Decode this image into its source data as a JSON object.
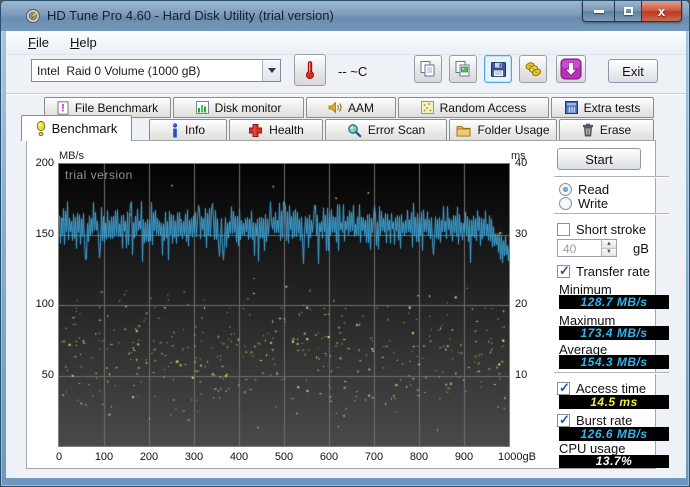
{
  "window": {
    "title": "HD Tune Pro 4.60 - Hard Disk Utility (trial version)"
  },
  "menu": {
    "items": [
      {
        "label": "File"
      },
      {
        "label": "Help"
      }
    ]
  },
  "toolbar": {
    "drive_select": "Intel  Raid 0 Volume (1000 gB)",
    "temperature": "-- ~C",
    "exit_label": "Exit",
    "button_icons": [
      "thermometer-icon",
      "copy-pages-icon",
      "copy-image-icon",
      "save-floppy-icon",
      "gold-coins-icon",
      "download-arrow-icon"
    ]
  },
  "tabs": {
    "row1": [
      {
        "label": "File Benchmark",
        "icon": "file-benchmark-icon"
      },
      {
        "label": "Disk monitor",
        "icon": "disk-monitor-icon"
      },
      {
        "label": "AAM",
        "icon": "aam-speaker-icon"
      },
      {
        "label": "Random Access",
        "icon": "random-access-icon"
      },
      {
        "label": "Extra tests",
        "icon": "extra-tests-icon"
      }
    ],
    "row2": [
      {
        "label": "Benchmark",
        "icon": "benchmark-icon",
        "active": true
      },
      {
        "label": "Info",
        "icon": "info-icon"
      },
      {
        "label": "Health",
        "icon": "health-icon"
      },
      {
        "label": "Error Scan",
        "icon": "error-scan-icon"
      },
      {
        "label": "Folder Usage",
        "icon": "folder-usage-icon"
      },
      {
        "label": "Erase",
        "icon": "erase-icon"
      }
    ]
  },
  "panel": {
    "start_label": "Start",
    "mode": {
      "read_label": "Read",
      "write_label": "Write",
      "read_checked": true,
      "write_checked": false
    },
    "short_stroke": {
      "label": "Short stroke",
      "checked": false,
      "value": "40",
      "unit": "gB"
    },
    "transfer_rate": {
      "label": "Transfer rate",
      "checked": true
    },
    "stats": [
      {
        "label": "Minimum",
        "value": "128.7 MB/s",
        "color": "#35b4ec"
      },
      {
        "label": "Maximum",
        "value": "173.4 MB/s",
        "color": "#35b4ec"
      },
      {
        "label": "Average",
        "value": "154.3 MB/s",
        "color": "#35b4ec"
      }
    ],
    "access_time": {
      "label": "Access time",
      "checked": true,
      "value": "14.5 ms",
      "color": "#f2ea3c"
    },
    "burst_rate": {
      "label": "Burst rate",
      "checked": true,
      "value": "126.6 MB/s",
      "color": "#35b4ec"
    },
    "cpu_usage": {
      "label": "CPU usage",
      "value": "13.7%",
      "color": "#ffffff"
    }
  },
  "chart_data": {
    "type": "line",
    "watermark": "trial version",
    "x_axis": {
      "ticks": [
        "0",
        "100",
        "200",
        "300",
        "400",
        "500",
        "600",
        "700",
        "800",
        "900"
      ],
      "last_tick_label": "1000gB",
      "range": [
        0,
        1000
      ],
      "unit": "gB"
    },
    "y_left": {
      "label": "MB/s",
      "ticks": [
        200,
        150,
        100,
        50
      ],
      "range": [
        0,
        200
      ]
    },
    "y_right": {
      "label": "ms",
      "ticks": [
        40,
        30,
        20,
        10
      ],
      "range": [
        0,
        40
      ]
    },
    "grid": true,
    "grid_color": "#6f6f6f",
    "plot_bg_top": "#030303",
    "plot_bg_bottom": "#4a4a4a",
    "series": [
      {
        "name": "transfer-rate",
        "type": "line",
        "axis": "left",
        "unit": "MB/s",
        "color": "#41a8dc",
        "min": 128.7,
        "max": 173.4,
        "avg": 154.3,
        "end_drop_to": 137,
        "seed": 11
      },
      {
        "name": "access-time",
        "type": "scatter",
        "axis": "right",
        "unit": "ms",
        "color": "#f0ec7c",
        "avg": 14.5,
        "spread_ms": [
          2,
          24
        ],
        "outlier_ms": [
          26,
          38
        ],
        "count": 430,
        "outlier_count": 12,
        "seed": 29
      }
    ]
  }
}
